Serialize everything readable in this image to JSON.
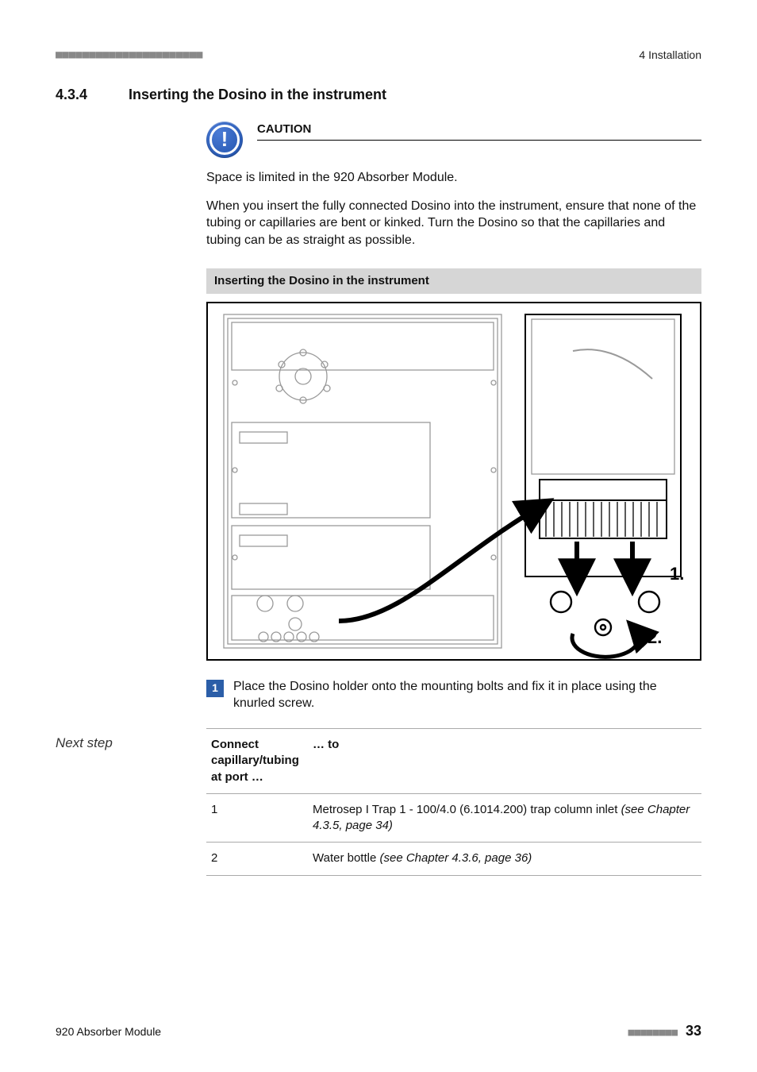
{
  "header": {
    "dashes": "■■■■■■■■■■■■■■■■■■■■■■",
    "right": "4 Installation"
  },
  "section": {
    "number": "4.3.4",
    "title": "Inserting the Dosino in the instrument"
  },
  "caution": {
    "label": "CAUTION",
    "para1": "Space is limited in the 920 Absorber Module.",
    "para2": "When you insert the fully connected Dosino into the instrument, ensure that none of the tubing or capillaries are bent or kinked. Turn the Dosino so that the capillaries and tubing can be as straight as possible."
  },
  "inset": {
    "heading": "Inserting the Dosino in the instrument",
    "label1": "1.",
    "label2": "2."
  },
  "step": {
    "num": "1",
    "text": "Place the Dosino holder onto the mounting bolts and fix it in place using the knurled screw."
  },
  "next_step_label": "Next step",
  "table": {
    "head_a": "Connect capillary/tubing at port …",
    "head_b": "… to",
    "rows": [
      {
        "a": "1",
        "b_text": "Metrosep I Trap 1 - 100/4.0 (6.1014.200) trap column inlet ",
        "b_ref": "(see Chapter 4.3.5, page 34)"
      },
      {
        "a": "2",
        "b_text": "Water bottle ",
        "b_ref": "(see Chapter 4.3.6, page 36)"
      }
    ]
  },
  "footer": {
    "left": "920 Absorber Module",
    "dashes": "■■■■■■■■",
    "page": "33"
  }
}
